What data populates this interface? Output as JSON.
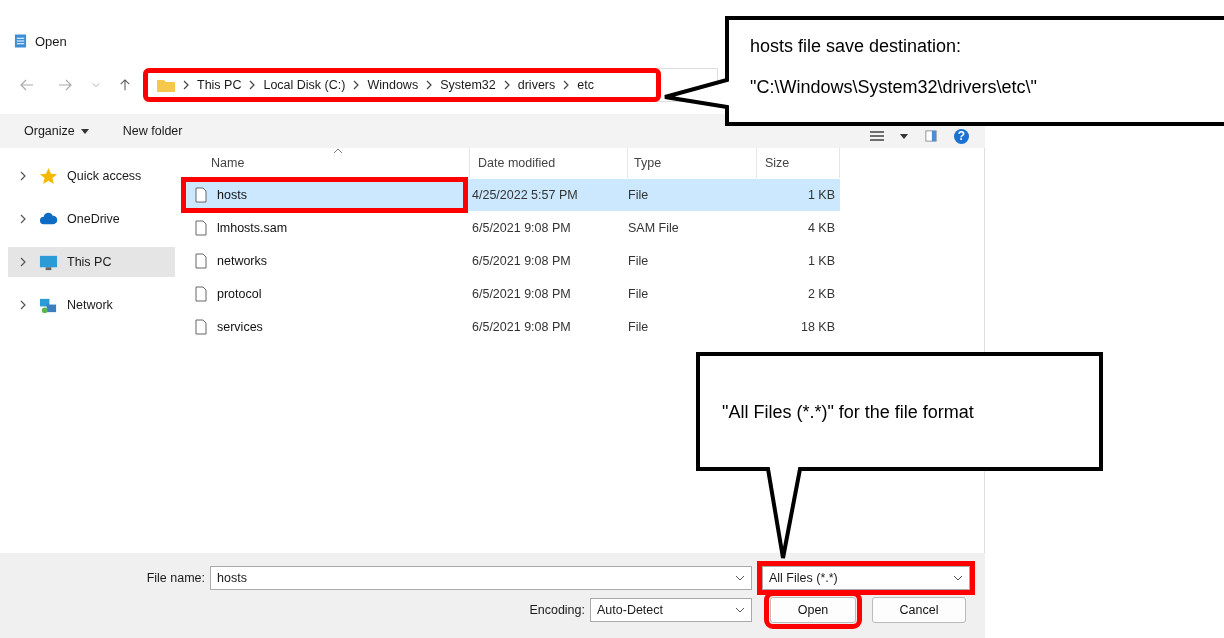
{
  "window": {
    "title": "Open"
  },
  "address_bar": {
    "highlighted": true,
    "segments": [
      "This PC",
      "Local Disk (C:)",
      "Windows",
      "System32",
      "drivers",
      "etc"
    ]
  },
  "toolbar": {
    "organize": "Organize",
    "new_folder": "New folder",
    "help": "?"
  },
  "sidebar": {
    "items": [
      {
        "label": "Quick access",
        "kind": "star",
        "selected": false
      },
      {
        "label": "OneDrive",
        "kind": "cloud",
        "selected": false
      },
      {
        "label": "This PC",
        "kind": "computer",
        "selected": true
      },
      {
        "label": "Network",
        "kind": "network",
        "selected": false
      }
    ]
  },
  "table": {
    "columns": [
      "Name",
      "Date modified",
      "Type",
      "Size"
    ],
    "rows": [
      {
        "name": "hosts",
        "date": "4/25/2022 5:57 PM",
        "type": "File",
        "size": "1 KB",
        "selected": true,
        "highlighted": true
      },
      {
        "name": "lmhosts.sam",
        "date": "6/5/2021 9:08 PM",
        "type": "SAM File",
        "size": "4 KB",
        "selected": false,
        "highlighted": false
      },
      {
        "name": "networks",
        "date": "6/5/2021 9:08 PM",
        "type": "File",
        "size": "1 KB",
        "selected": false,
        "highlighted": false
      },
      {
        "name": "protocol",
        "date": "6/5/2021 9:08 PM",
        "type": "File",
        "size": "2 KB",
        "selected": false,
        "highlighted": false
      },
      {
        "name": "services",
        "date": "6/5/2021 9:08 PM",
        "type": "File",
        "size": "18 KB",
        "selected": false,
        "highlighted": false
      }
    ]
  },
  "footer": {
    "file_name_label": "File name:",
    "file_name": "hosts",
    "file_type": "All Files  (*.*)",
    "file_type_highlighted": true,
    "encoding_label": "Encoding:",
    "encoding": "Auto-Detect",
    "buttons": [
      {
        "label": "Open",
        "highlighted": true
      },
      {
        "label": "Cancel",
        "highlighted": false
      }
    ]
  },
  "callouts": [
    {
      "lines": [
        "hosts file save destination:",
        "\"C:\\Windows\\System32\\drivers\\etc\\\""
      ]
    },
    {
      "lines": [
        "\"All Files (*.*)\" for the file format"
      ]
    }
  ]
}
